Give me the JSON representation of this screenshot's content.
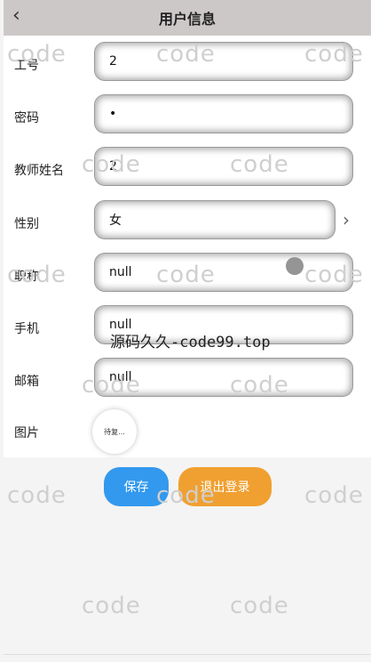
{
  "header": {
    "back_icon": "chevron-left-icon",
    "title": "用户信息"
  },
  "fields": {
    "job_no": {
      "label": "工号",
      "value": "2"
    },
    "password": {
      "label": "密码",
      "value": "•"
    },
    "teacher_name": {
      "label": "教师姓名",
      "value": "2"
    },
    "gender": {
      "label": "性别",
      "value": "女",
      "chevron_icon": "chevron-right-icon"
    },
    "title": {
      "label": "职称",
      "value": "null"
    },
    "phone": {
      "label": "手机",
      "value": "null"
    },
    "email": {
      "label": "邮箱",
      "value": "null"
    },
    "photo": {
      "label": "图片",
      "avatar_text": "待复..."
    }
  },
  "buttons": {
    "save": "保存",
    "logout": "退出登录"
  },
  "watermarks": {
    "word": "code",
    "site": "源码久久-code99.top"
  },
  "colors": {
    "header": "#cdc8c8",
    "save": "#3399ee",
    "logout": "#f0a030"
  }
}
